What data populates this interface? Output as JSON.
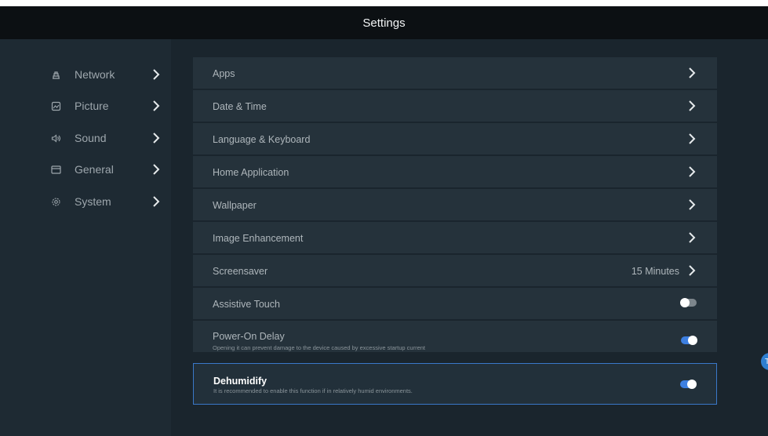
{
  "header": {
    "title": "Settings"
  },
  "sidebar": {
    "items": [
      {
        "label": "Network",
        "icon": "network-icon"
      },
      {
        "label": "Picture",
        "icon": "picture-icon"
      },
      {
        "label": "Sound",
        "icon": "sound-icon"
      },
      {
        "label": "General",
        "icon": "general-icon"
      },
      {
        "label": "System",
        "icon": "system-icon"
      }
    ]
  },
  "main": {
    "rows": [
      {
        "label": "Apps",
        "type": "nav"
      },
      {
        "label": "Date & Time",
        "type": "nav"
      },
      {
        "label": "Language & Keyboard",
        "type": "nav"
      },
      {
        "label": "Home Application",
        "type": "nav"
      },
      {
        "label": "Wallpaper",
        "type": "nav"
      },
      {
        "label": "Image Enhancement",
        "type": "nav"
      },
      {
        "label": "Screensaver",
        "type": "nav",
        "value": "15 Minutes"
      },
      {
        "label": "Assistive Touch",
        "type": "toggle",
        "on": false
      },
      {
        "label": "Power-On Delay",
        "type": "toggle",
        "on": true,
        "description": "Opening it can prevent damage to the device caused by excessive startup current"
      },
      {
        "label": "Dehumidify",
        "type": "toggle",
        "on": true,
        "focused": true,
        "description": "It is recommended to enable this function if in relatively humid environments."
      }
    ]
  },
  "colors": {
    "topbar": "#0c1013",
    "background": "#1e2a33",
    "row": "#25323b",
    "toggle_on": "#3d7fe0",
    "toggle_off": "#7d868c",
    "focus_border": "#3a78c9"
  }
}
